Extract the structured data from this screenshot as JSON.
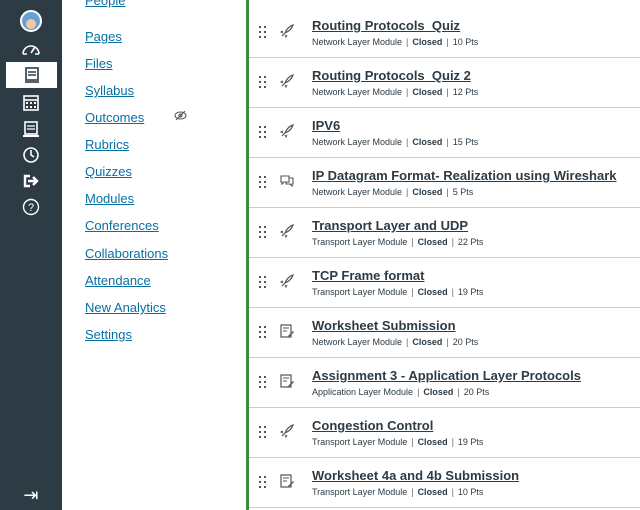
{
  "global_nav": {
    "items": [
      {
        "name": "account-avatar"
      },
      {
        "name": "dashboard-icon"
      },
      {
        "name": "courses-icon",
        "active": true
      },
      {
        "name": "calendar-icon"
      },
      {
        "name": "inbox-icon"
      },
      {
        "name": "history-icon"
      },
      {
        "name": "commons-icon"
      },
      {
        "name": "help-icon"
      }
    ],
    "collapse_icon": "collapse-arrow-icon"
  },
  "course_nav": {
    "items": [
      {
        "label": "People",
        "partial": true
      },
      {
        "label": "Pages"
      },
      {
        "label": "Files"
      },
      {
        "label": "Syllabus"
      },
      {
        "label": "Outcomes",
        "hidden": true
      },
      {
        "label": "Rubrics"
      },
      {
        "label": "Quizzes"
      },
      {
        "label": "Modules"
      },
      {
        "label": "Conferences"
      },
      {
        "label": "Collaborations"
      },
      {
        "label": "Attendance"
      },
      {
        "label": "New Analytics"
      },
      {
        "label": "Settings"
      }
    ]
  },
  "assignments": [
    {
      "icon": "quiz-rocket-icon",
      "title": "Routing Protocols_Quiz",
      "module": "Network Layer Module",
      "status": "Closed",
      "points": "10 Pts"
    },
    {
      "icon": "quiz-rocket-icon",
      "title": "Routing Protocols_Quiz 2",
      "module": "Network Layer Module",
      "status": "Closed",
      "points": "12 Pts"
    },
    {
      "icon": "quiz-rocket-icon",
      "title": "IPV6",
      "module": "Network Layer Module",
      "status": "Closed",
      "points": "15 Pts"
    },
    {
      "icon": "discussion-icon",
      "title": "IP Datagram Format- Realization using Wireshark",
      "module": "Network Layer Module",
      "status": "Closed",
      "points": "5 Pts"
    },
    {
      "icon": "quiz-rocket-icon",
      "title": "Transport Layer and UDP",
      "module": "Transport Layer Module",
      "status": "Closed",
      "points": "22 Pts"
    },
    {
      "icon": "quiz-rocket-icon",
      "title": "TCP Frame format",
      "module": "Transport Layer Module",
      "status": "Closed",
      "points": "19 Pts"
    },
    {
      "icon": "assignment-icon",
      "title": "Worksheet Submission",
      "module": "Network Layer Module",
      "status": "Closed",
      "points": "20 Pts"
    },
    {
      "icon": "assignment-icon",
      "title": "Assignment 3 - Application Layer Protocols",
      "module": "Application Layer Module",
      "status": "Closed",
      "points": "20 Pts"
    },
    {
      "icon": "quiz-rocket-icon",
      "title": "Congestion Control",
      "module": "Transport Layer Module",
      "status": "Closed",
      "points": "19 Pts"
    },
    {
      "icon": "assignment-icon",
      "title": "Worksheet 4a and 4b Submission",
      "module": "Transport Layer Module",
      "status": "Closed",
      "points": "10 Pts"
    }
  ]
}
